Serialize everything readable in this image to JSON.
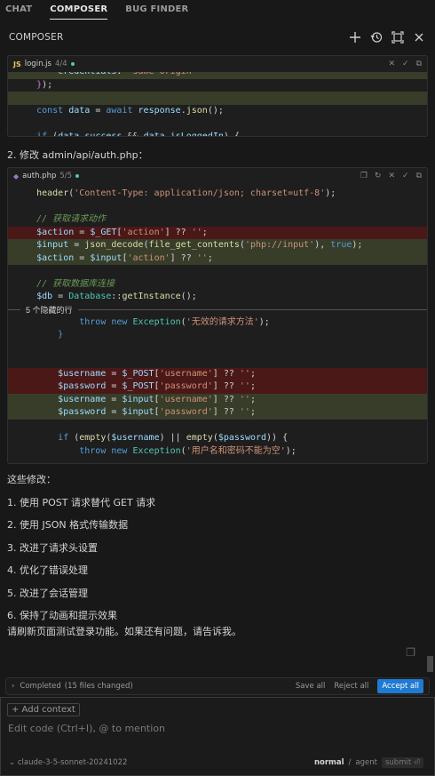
{
  "tabs": [
    "CHAT",
    "COMPOSER",
    "BUG FINDER"
  ],
  "composer": {
    "title": "COMPOSER"
  },
  "block1": {
    "file": "login.js",
    "counter": "4/4",
    "lines": [
      {
        "t": "        credentials: 'same-origin'",
        "cls": "added"
      },
      {
        "t": "    });",
        "cls": ""
      },
      {
        "t": "",
        "cls": "added"
      },
      {
        "t": "    const data = await response.json();",
        "cls": ""
      },
      {
        "t": "",
        "cls": ""
      },
      {
        "t": "    if (data.success && data.isLoggedIn) {",
        "cls": ""
      }
    ]
  },
  "step2_label": "2. 修改 admin/api/auth.php：",
  "block2": {
    "file": "auth.php",
    "counter": "5/5",
    "hidden_label": "5 个隐藏的行"
  },
  "summary": {
    "intro": "这些修改：",
    "items": [
      "1. 使用 POST 请求替代 GET 请求",
      "2. 使用 JSON 格式传输数据",
      "3. 改进了请求头设置",
      "4. 优化了错误处理",
      "5. 改进了会话管理",
      "6. 保持了动画和提示效果"
    ],
    "outro": "请刷新页面测试登录功能。如果还有问题，请告诉我。"
  },
  "completed": {
    "label": "Completed",
    "files": "(15 files changed)",
    "save_all": "Save all",
    "reject_all": "Reject all",
    "accept_all": "Accept all"
  },
  "input": {
    "add_context": "+ Add context",
    "placeholder": "Edit code (Ctrl+I), @ to mention",
    "model": "claude-3-5-sonnet-20241022",
    "mode_normal": "normal",
    "mode_agent": "agent",
    "submit": "submit"
  },
  "colors": {
    "accent": "#1f7ad1",
    "removed_bg": "#4b1818",
    "added_bg": "#373d29"
  }
}
